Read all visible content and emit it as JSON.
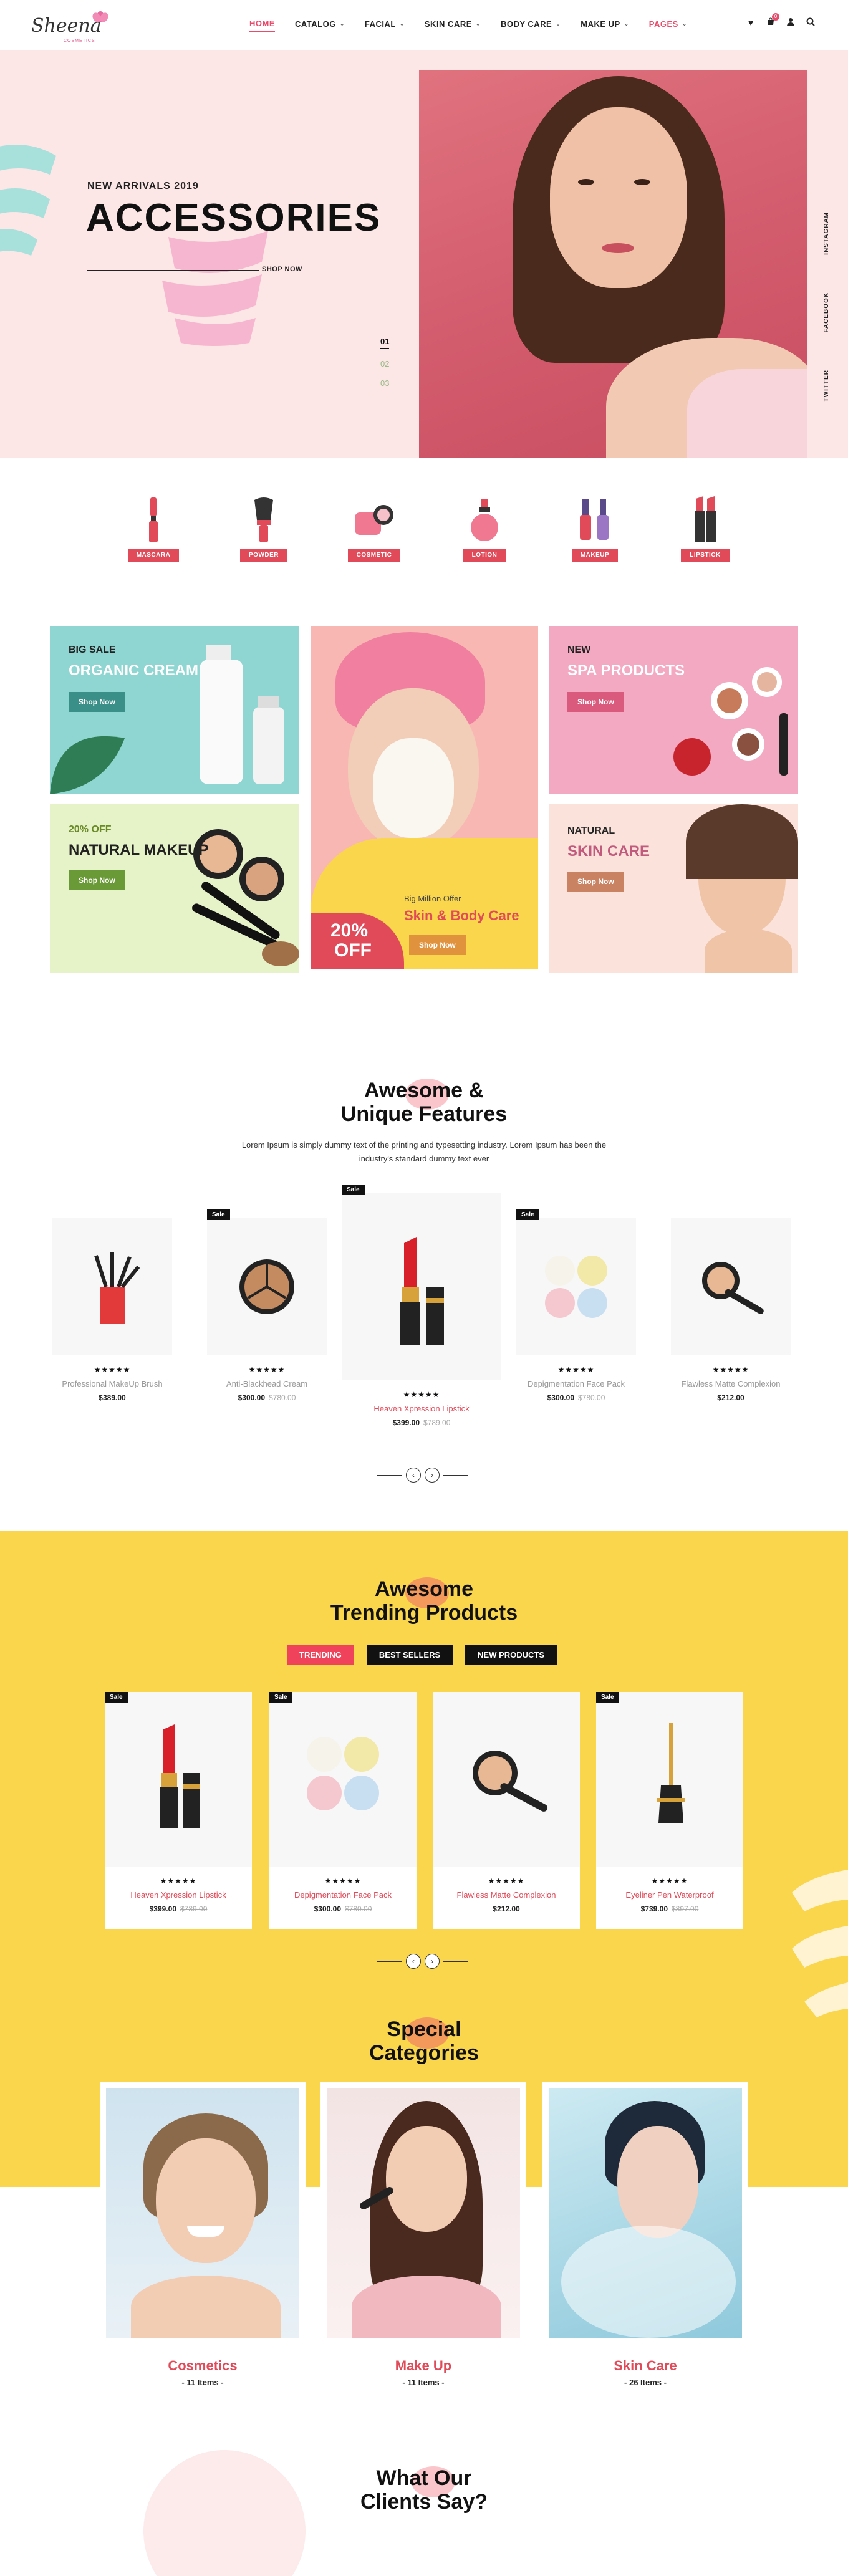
{
  "brand": {
    "name": "Sheena",
    "tagline": "COSMETICS"
  },
  "nav": {
    "items": [
      {
        "label": "HOME",
        "active": true
      },
      {
        "label": "CATALOG"
      },
      {
        "label": "FACIAL"
      },
      {
        "label": "SKIN CARE"
      },
      {
        "label": "BODY CARE"
      },
      {
        "label": "MAKE UP"
      },
      {
        "label": "PAGES"
      }
    ],
    "cart_count": "0",
    "icons": [
      "heart-icon",
      "cart-icon",
      "user-icon",
      "search-icon"
    ]
  },
  "hero": {
    "subtitle": "NEW ARRIVALS 2019",
    "title": "ACCESSORIES",
    "cta": "SHOP NOW",
    "slides": [
      "01",
      "02",
      "03"
    ],
    "social": [
      "INSTAGRAM",
      "FACEBOOK",
      "TWITTER"
    ]
  },
  "categories": [
    "MASCARA",
    "POWDER",
    "COSMETIC",
    "LOTION",
    "MAKEUP",
    "LIPSTICK"
  ],
  "banners": {
    "b1": {
      "sub": "BIG SALE",
      "title": "ORGANIC CREAM",
      "cta": "Shop Now"
    },
    "b2": {
      "sub": "20% OFF",
      "title": "NATURAL MAKEUP",
      "cta": "Shop Now"
    },
    "b3": {
      "offer": "Big Million Offer",
      "title": "Skin & Body Care",
      "cta": "Shop Now",
      "pct": "20%",
      "off": "OFF"
    },
    "b4": {
      "sub": "NEW",
      "title": "SPA PRODUCTS",
      "cta": "Shop Now"
    },
    "b5": {
      "sub": "NATURAL",
      "title": "SKIN CARE",
      "cta": "Shop Now"
    }
  },
  "features": {
    "title1": "Awesome &",
    "title2": "Unique Features",
    "desc": "Lorem Ipsum is simply dummy text of the printing and typesetting industry. Lorem Ipsum has been the industry's standard dummy text ever",
    "products": [
      {
        "name": "Professional MakeUp Brush",
        "price": "$389.00",
        "old": "",
        "sale": "",
        "stars": "★★★★★"
      },
      {
        "name": "Anti-Blackhead Cream",
        "price": "$300.00",
        "old": "$780.00",
        "sale": "Sale",
        "stars": "★★★★★"
      },
      {
        "name": "Heaven Xpression Lipstick",
        "price": "$399.00",
        "old": "$789.00",
        "sale": "Sale",
        "stars": "★★★★★"
      },
      {
        "name": "Depigmentation Face Pack",
        "price": "$300.00",
        "old": "$780.00",
        "sale": "Sale",
        "stars": "★★★★★"
      },
      {
        "name": "Flawless Matte Complexion",
        "price": "$212.00",
        "old": "",
        "sale": "",
        "stars": "★★★★★"
      }
    ]
  },
  "trending": {
    "title1": "Awesome",
    "title2": "Trending Products",
    "tabs": [
      "TRENDING",
      "BEST SELLERS",
      "NEW PRODUCTS"
    ],
    "products": [
      {
        "name": "Heaven Xpression Lipstick",
        "price": "$399.00",
        "old": "$789.00",
        "sale": "Sale",
        "stars": "★★★★★"
      },
      {
        "name": "Depigmentation Face Pack",
        "price": "$300.00",
        "old": "$780.00",
        "sale": "Sale",
        "stars": "★★★★★"
      },
      {
        "name": "Flawless Matte Complexion",
        "price": "$212.00",
        "old": "",
        "sale": "",
        "stars": "★★★★★"
      },
      {
        "name": "Eyeliner Pen Waterproof",
        "price": "$739.00",
        "old": "$897.00",
        "sale": "Sale",
        "stars": "★★★★★"
      }
    ]
  },
  "special": {
    "title1": "Special",
    "title2": "Categories",
    "items": [
      {
        "name": "Cosmetics",
        "count": "- 11 Items -"
      },
      {
        "name": "Make Up",
        "count": "- 11 Items -"
      },
      {
        "name": "Skin Care",
        "count": "- 26 Items -"
      }
    ]
  },
  "testimonials": {
    "title1": "What Our",
    "title2": "Clients Say?"
  },
  "colors": {
    "accent": "#e04a59",
    "hero_bg": "#fde6e6",
    "yellow": "#f9d64c"
  }
}
